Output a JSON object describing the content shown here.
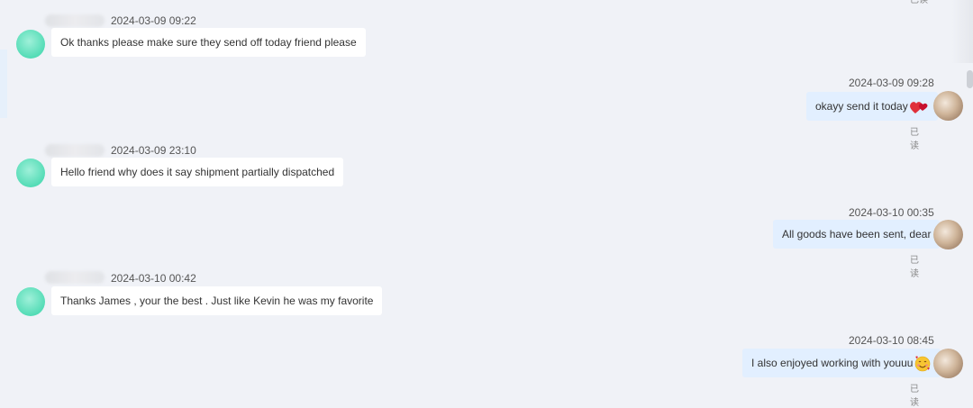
{
  "read_label": "已读",
  "messages": [
    {
      "side": "in",
      "time": "2024-03-09 09:22",
      "text": "Ok thanks please make sure they send off today friend please"
    },
    {
      "side": "out",
      "time": "2024-03-09 09:28",
      "text": "okayy send it today",
      "emoji": "hearts-emoji"
    },
    {
      "side": "in",
      "time": "2024-03-09 23:10",
      "text": "Hello friend why does it say shipment partially dispatched"
    },
    {
      "side": "out",
      "time": "2024-03-10 00:35",
      "text": "All goods have been sent, dear"
    },
    {
      "side": "in",
      "time": "2024-03-10 00:42",
      "text": "Thanks James , your the best . Just like Kevin he was my favorite"
    },
    {
      "side": "out",
      "time": "2024-03-10 08:45",
      "text": "I also enjoyed working with youuu",
      "emoji": "smiling-face-hearts-emoji"
    }
  ],
  "colors": {
    "background": "#f0f2f7",
    "incoming_bubble": "#ffffff",
    "outgoing_bubble": "#e2efff",
    "customer_avatar": "#54dcb6"
  }
}
